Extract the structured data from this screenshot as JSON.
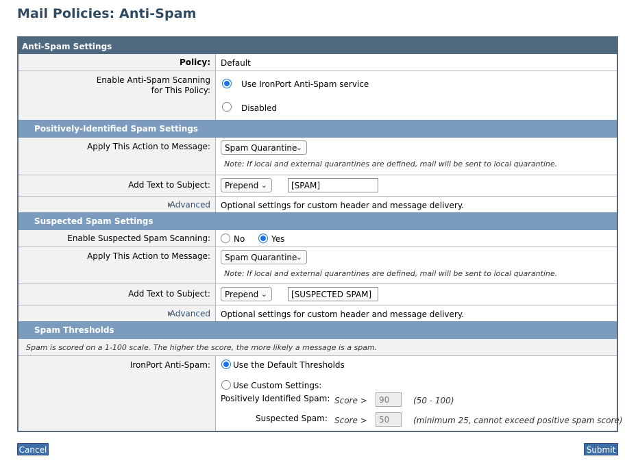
{
  "page": {
    "title": "Mail Policies: Anti-Spam"
  },
  "panel": {
    "title": "Anti-Spam Settings"
  },
  "policy": {
    "label": "Policy:",
    "value": "Default"
  },
  "scanning": {
    "label_line1": "Enable Anti-Spam Scanning",
    "label_line2": "for This Policy:",
    "option_ironport": "Use IronPort Anti-Spam service",
    "option_disabled": "Disabled",
    "selected": "ironport"
  },
  "positive": {
    "header": "Positively-Identified Spam Settings",
    "action_label": "Apply This Action to Message:",
    "action_value": "Spam Quarantine",
    "note": "Note: If local and external quarantines are defined, mail will be sent to local quarantine.",
    "subject_label": "Add Text to Subject:",
    "subject_mode": "Prepend",
    "subject_text": "[SPAM]",
    "advanced_label": "Advanced",
    "advanced_desc": "Optional settings for custom header and message delivery."
  },
  "suspected": {
    "header": "Suspected Spam Settings",
    "enable_label": "Enable Suspected Spam Scanning:",
    "option_no": "No",
    "option_yes": "Yes",
    "selected": "yes",
    "action_label": "Apply This Action to Message:",
    "action_value": "Spam Quarantine",
    "note": "Note: If local and external quarantines are defined, mail will be sent to local quarantine.",
    "subject_label": "Add Text to Subject:",
    "subject_mode": "Prepend",
    "subject_text": "[SUSPECTED SPAM]",
    "advanced_label": "Advanced",
    "advanced_desc": "Optional settings for custom header and message delivery."
  },
  "thresholds": {
    "header": "Spam Thresholds",
    "description": "Spam is scored on a 1-100 scale. The higher the score, the more likely a message is a spam.",
    "ironport_label": "IronPort Anti-Spam:",
    "option_default": "Use the Default Thresholds",
    "option_custom": "Use Custom Settings:",
    "selected": "default",
    "positive_label": "Positively Identified Spam:",
    "positive_score_label": "Score >",
    "positive_score_value": "90",
    "positive_range": "(50 - 100)",
    "suspected_label": "Suspected Spam:",
    "suspected_score_label": "Score >",
    "suspected_score_value": "50",
    "suspected_range": "(minimum 25, cannot exceed positive spam score)"
  },
  "buttons": {
    "cancel": "Cancel",
    "submit": "Submit"
  },
  "icons": {
    "radio_selected": "radio-selected-icon",
    "radio_unselected": "radio-unselected-icon",
    "chevron": "chevron-down-icon",
    "disclosure": "disclosure-triangle-icon"
  },
  "colors": {
    "title": "#2e4a62",
    "panel_header": "#4e6880",
    "section_header": "#7b9bbf",
    "button": "#3e6fa8",
    "radio_accent": "#1a73e8"
  }
}
